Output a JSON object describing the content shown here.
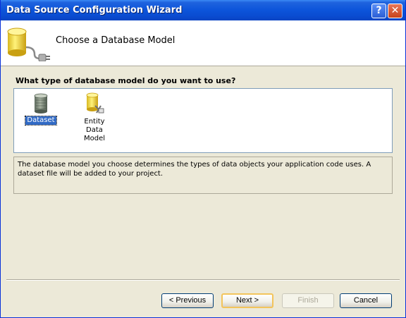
{
  "window": {
    "title": "Data Source Configuration Wizard"
  },
  "titlebar_buttons": {
    "help": "?",
    "close": "✕"
  },
  "header": {
    "title": "Choose a Database Model"
  },
  "question": "What type of database model do you want to use?",
  "models": [
    {
      "label": "Dataset",
      "icon": "dataset-icon",
      "selected": true
    },
    {
      "label_line1": "Entity Data",
      "label_line2": "Model",
      "icon": "entity-data-model-icon",
      "selected": false
    }
  ],
  "description": "The database model you choose determines the types of data objects your application code uses. A dataset file will be added to your project.",
  "buttons": {
    "previous": "< Previous",
    "next": "Next >",
    "finish": "Finish",
    "cancel": "Cancel"
  },
  "colors": {
    "selection": "#316AC5",
    "titlebar": "#0A4BD0",
    "dialog_bg": "#ECE9D8"
  }
}
